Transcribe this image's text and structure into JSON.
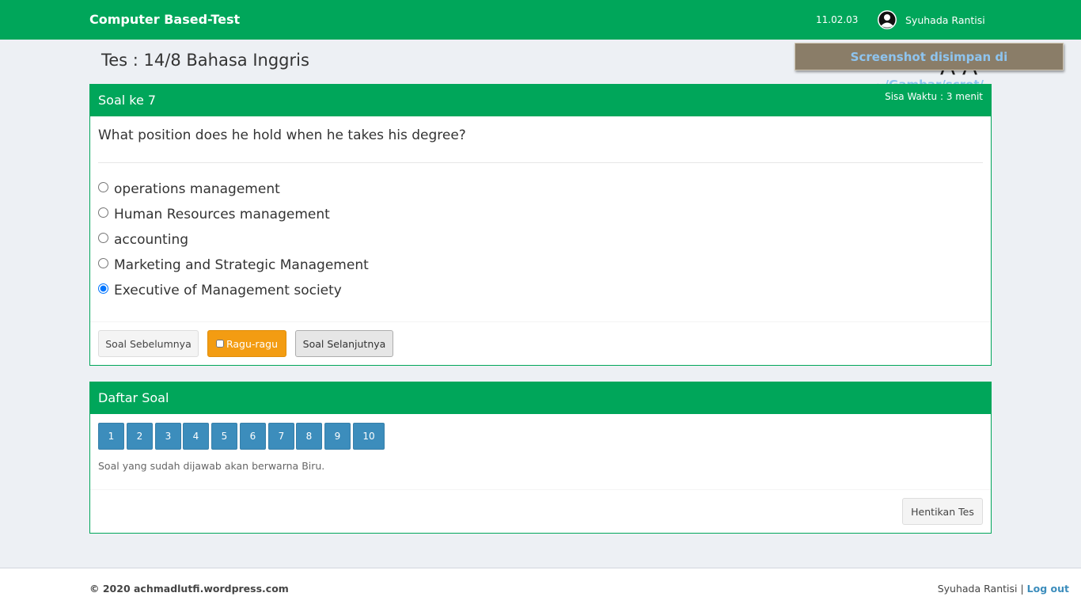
{
  "header": {
    "brand": "Computer Based-Test",
    "clock": "11.02.03",
    "user_name": "Syuhada Rantisi"
  },
  "page": {
    "title": "Tes : 14/8 Bahasa Inggris",
    "font_size_control": "A A"
  },
  "toast": {
    "text": "Screenshot disimpan di ~/Gambar/scrot/"
  },
  "question_panel": {
    "title": "Soal ke 7",
    "timer": "Sisa Waktu : 3 menit",
    "question": "What position does he hold when he takes his degree?",
    "options": [
      {
        "label": "operations management",
        "selected": false
      },
      {
        "label": "Human Resources management",
        "selected": false
      },
      {
        "label": "accounting",
        "selected": false
      },
      {
        "label": "Marketing and Strategic Management",
        "selected": false
      },
      {
        "label": "Executive of Management society",
        "selected": true
      }
    ],
    "prev_label": "Soal Sebelumnya",
    "doubt_label": "Ragu-ragu",
    "next_label": "Soal Selanjutnya"
  },
  "list_panel": {
    "title": "Daftar Soal",
    "numbers": [
      "1",
      "2",
      "3",
      "4",
      "5",
      "6",
      "7",
      "8",
      "9",
      "10"
    ],
    "hint": "Soal yang sudah dijawab akan berwarna Biru.",
    "stop_label": "Hentikan Tes"
  },
  "footer": {
    "copyright": "© 2020 achmadlutfi.wordpress.com",
    "user_name": "Syuhada Rantisi",
    "separator": "|",
    "logout_label": "Log out"
  },
  "colors": {
    "primary_green": "#00a65a",
    "answered_blue": "#3c8dbc",
    "warning_orange": "#f39c12"
  }
}
